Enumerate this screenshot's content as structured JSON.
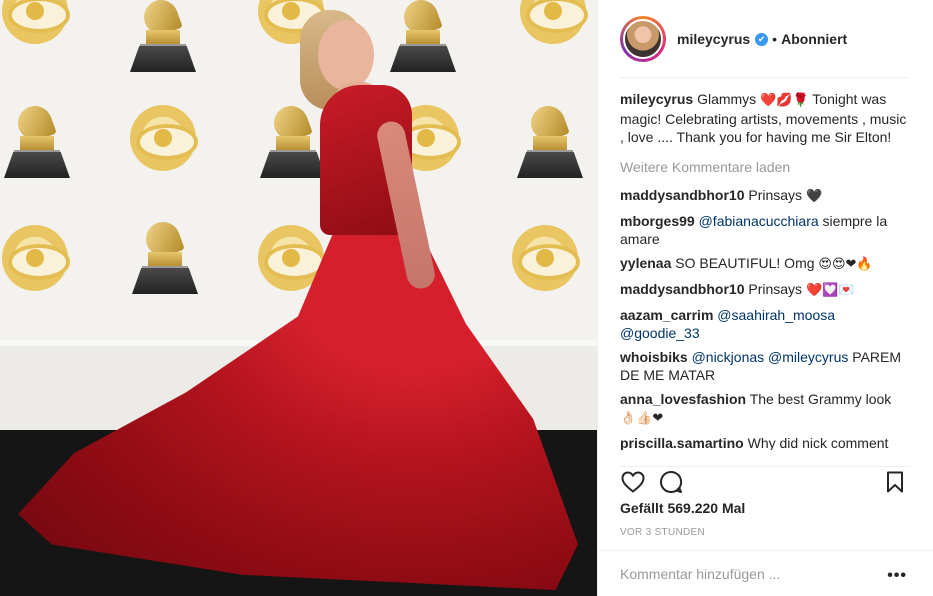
{
  "header": {
    "username": "mileycyrus",
    "verified_mark": "✔",
    "separator": "•",
    "follow_status": "Abonniert"
  },
  "caption": {
    "username": "mileycyrus",
    "text_before": "Glammys",
    "emojis": "❤️💋🌹",
    "text_after": "Tonight was magic! Celebrating artists, movements , music , love .... Thank you for having me Sir Elton!"
  },
  "load_more": "Weitere Kommentare laden",
  "comments": [
    {
      "user": "maddysandbhor10",
      "mention": "",
      "text": "Prinsays",
      "emojis": "🖤"
    },
    {
      "user": "mborges99",
      "mention": "@fabianacucchiara",
      "text": "siempre la amare",
      "emojis": ""
    },
    {
      "user": "yylenaa",
      "mention": "",
      "text": "SO BEAUTIFUL! Omg",
      "emojis": "😍😍❤🔥"
    },
    {
      "user": "maddysandbhor10",
      "mention": "",
      "text": "Prinsays",
      "emojis": "❤️💟💌"
    },
    {
      "user": "aazam_carrim",
      "mention": "@saahirah_moosa @goodie_33",
      "text": "",
      "emojis": ""
    },
    {
      "user": "whoisbiks",
      "mention": "@nickjonas @mileycyrus",
      "text": "PAREM DE ME MATAR",
      "emojis": ""
    },
    {
      "user": "anna_lovesfashion",
      "mention": "",
      "text": "The best Grammy look",
      "emojis": "👌🏻👍🏻❤"
    },
    {
      "user": "priscilla.samartino",
      "mention": "",
      "text": "Why did nick comment",
      "emojis": ""
    }
  ],
  "actions": {
    "like_icon": "heart-icon",
    "comment_icon": "comment-bubble-icon",
    "save_icon": "bookmark-icon"
  },
  "likes_text": "Gefällt 569.220 Mal",
  "timestamp": "VOR 3 STUNDEN",
  "add_comment": {
    "placeholder": "Kommentar hinzufügen ...",
    "more_label": "•••"
  }
}
